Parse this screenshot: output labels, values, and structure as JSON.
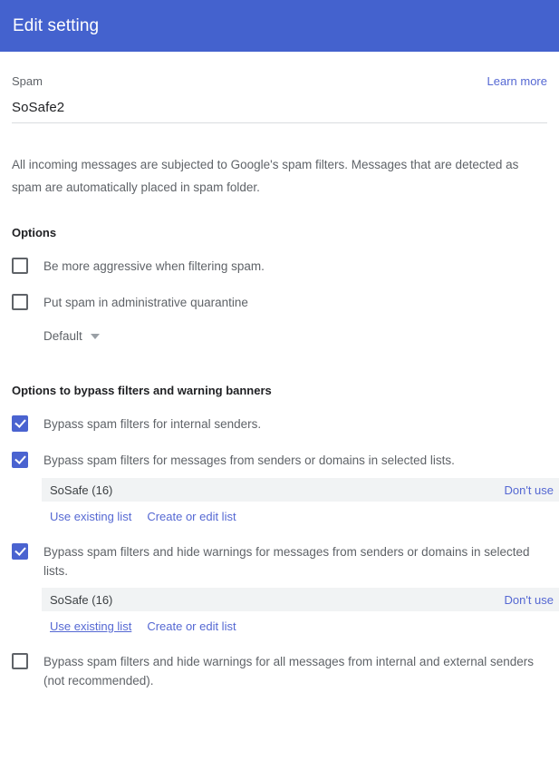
{
  "header": {
    "title": "Edit setting"
  },
  "meta": {
    "setting_type": "Spam",
    "learn_more_label": "Learn more"
  },
  "name_field": {
    "value": "SoSafe2"
  },
  "description": "All incoming messages are subjected to Google's spam filters. Messages that are detected as spam are automatically placed in spam folder.",
  "options_section": {
    "heading": "Options",
    "checkboxes": [
      {
        "label": "Be more aggressive when filtering spam.",
        "checked": false
      },
      {
        "label": "Put spam in administrative quarantine",
        "checked": false
      }
    ],
    "quarantine_dropdown": {
      "selected": "Default",
      "caret_icon": "chevron-down-icon"
    }
  },
  "bypass_section": {
    "heading": "Options to bypass filters and warning banners",
    "items": [
      {
        "label": "Bypass spam filters for internal senders.",
        "checked": true,
        "has_list": false
      },
      {
        "label": "Bypass spam filters for messages from senders or domains in selected lists.",
        "checked": true,
        "has_list": true,
        "list": {
          "name": "SoSafe (16)",
          "dont_use_label": "Don't use",
          "use_existing_label": "Use existing list",
          "create_edit_label": "Create or edit list",
          "use_existing_underlined": false
        }
      },
      {
        "label": "Bypass spam filters and hide warnings for messages from senders or domains in selected lists.",
        "checked": true,
        "has_list": true,
        "list": {
          "name": "SoSafe (16)",
          "dont_use_label": "Don't use",
          "use_existing_label": "Use existing list",
          "create_edit_label": "Create or edit list",
          "use_existing_underlined": true
        }
      },
      {
        "label": "Bypass spam filters and hide warnings for all messages from internal and external senders (not recommended).",
        "checked": false,
        "has_list": false
      }
    ]
  },
  "colors": {
    "header_blue": "#4462ce",
    "checkbox_checked": "#4a63d0",
    "link_blue": "#5568d3",
    "list_row_bg": "#f1f3f4"
  }
}
